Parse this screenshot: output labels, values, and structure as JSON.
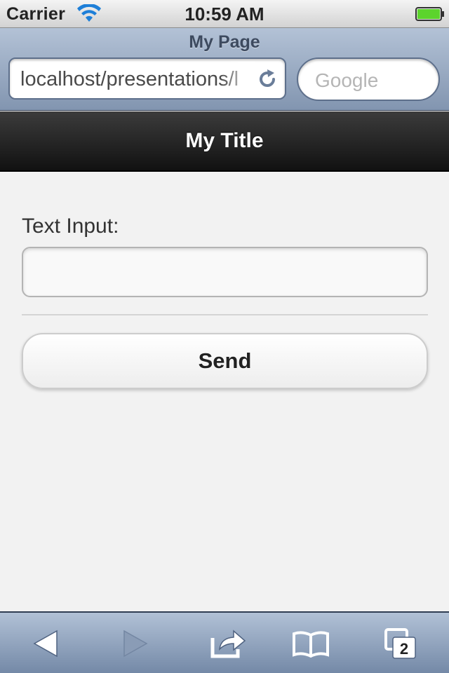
{
  "status_bar": {
    "carrier": "Carrier",
    "time": "10:59 AM",
    "wifi_icon": "wifi-icon",
    "battery_icon": "battery-icon",
    "battery_color": "#5cd42c"
  },
  "browser": {
    "page_title": "My Page",
    "url": "localhost/presentations/l",
    "search_placeholder": "Google",
    "reload_icon": "reload-icon"
  },
  "header": {
    "title": "My Title"
  },
  "form": {
    "label": "Text Input:",
    "input_value": "",
    "send_label": "Send"
  },
  "toolbar": {
    "back_icon": "back-arrow-icon",
    "forward_icon": "forward-arrow-icon",
    "share_icon": "share-icon",
    "bookmarks_icon": "bookmarks-icon",
    "tabs_icon": "tabs-icon",
    "tabs_count": "2"
  }
}
